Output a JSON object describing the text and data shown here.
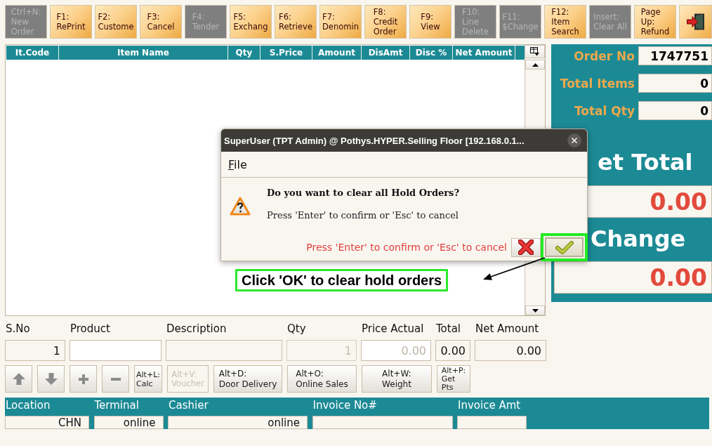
{
  "toolbar": {
    "buttons": [
      {
        "kind": "text",
        "lines": [
          "Ctrl+N:",
          "New",
          "Order"
        ],
        "disabled": true
      },
      {
        "kind": "text",
        "lines": [
          "F1:",
          "RePrint"
        ],
        "disabled": false
      },
      {
        "kind": "text",
        "lines": [
          "F2:",
          "Custome"
        ],
        "disabled": false
      },
      {
        "kind": "text",
        "lines": [
          "F3:",
          "Cancel"
        ],
        "disabled": false
      },
      {
        "kind": "text",
        "lines": [
          "F4:",
          "Tender"
        ],
        "disabled": true
      },
      {
        "kind": "text",
        "lines": [
          "F5:",
          "Exchang"
        ],
        "disabled": false
      },
      {
        "kind": "text",
        "lines": [
          "F6:",
          "Retrieve"
        ],
        "disabled": false
      },
      {
        "kind": "text",
        "lines": [
          "F7:",
          "Denomin"
        ],
        "disabled": false
      },
      {
        "kind": "text",
        "lines": [
          "F8:",
          "Credit",
          "Order"
        ],
        "disabled": false
      },
      {
        "kind": "text",
        "lines": [
          "F9:",
          "View"
        ],
        "disabled": false
      },
      {
        "kind": "text",
        "lines": [
          "F10:",
          "Line",
          "Delete"
        ],
        "disabled": true
      },
      {
        "kind": "text",
        "lines": [
          "F11:",
          "$Change"
        ],
        "disabled": true
      },
      {
        "kind": "text",
        "lines": [
          "F12:",
          "Item",
          "Search"
        ],
        "disabled": false
      },
      {
        "kind": "text",
        "lines": [
          "Insert:",
          "Clear All"
        ],
        "disabled": true
      },
      {
        "kind": "text",
        "lines": [
          "Page",
          "Up:",
          "Refund"
        ],
        "disabled": false
      },
      {
        "kind": "exit",
        "disabled": false
      }
    ]
  },
  "items_table": {
    "columns": [
      "It.Code",
      "Item Name",
      "Qty",
      "S.Price",
      "Amount",
      "DisAmt",
      "Disc %",
      "Net Amount"
    ]
  },
  "summary": {
    "fields": [
      {
        "label": "Order No",
        "value": "1747751"
      },
      {
        "label": "Total Items",
        "value": "0"
      },
      {
        "label": "Total Qty",
        "value": "0"
      }
    ],
    "totals": [
      {
        "label": "et Total",
        "value": "0.00"
      },
      {
        "label": "Change",
        "value": "0.00"
      }
    ]
  },
  "dialog": {
    "title": "SuperUser (TPT Admin) @ Pothys.HYPER.Selling Floor [192.168.0.1...",
    "menu": [
      {
        "label": "File"
      }
    ],
    "question": "Do you want to clear all Hold Orders?",
    "message": "Press 'Enter' to confirm or 'Esc' to cancel",
    "hint": "Press 'Enter' to confirm or 'Esc' to cancel",
    "buttons": [
      {
        "kind": "cancel",
        "highlighted": false
      },
      {
        "kind": "ok",
        "highlighted": true
      }
    ]
  },
  "callout": {
    "text": "Click 'OK' to clear hold orders"
  },
  "entry": {
    "fields": [
      {
        "label": "S.No",
        "value": "1",
        "editable": false,
        "disabled": false
      },
      {
        "label": "Product",
        "editable": true,
        "disabled": false
      },
      {
        "label": "Description",
        "editable": false,
        "disabled": false
      },
      {
        "label": "Qty",
        "value": "1",
        "editable": false,
        "disabled": true
      },
      {
        "label": "Price Actual",
        "placeholder": "0.00",
        "editable": true,
        "disabled": false
      },
      {
        "label": "Total",
        "value": "0.00",
        "editable": false,
        "disabled": false
      },
      {
        "label": "Net Amount",
        "value": "0.00",
        "editable": false,
        "disabled": false
      }
    ]
  },
  "actions": [
    {
      "kind": "up"
    },
    {
      "kind": "down"
    },
    {
      "kind": "add"
    },
    {
      "kind": "remove"
    },
    {
      "kind": "text",
      "lines": [
        "Alt+L:",
        "Calc"
      ],
      "disabled": false
    },
    {
      "kind": "text",
      "lines": [
        "Alt+V:",
        "Voucher"
      ],
      "disabled": true
    },
    {
      "kind": "text",
      "lines": [
        "Alt+D:",
        "Door Delivery"
      ],
      "disabled": false
    },
    {
      "kind": "text",
      "lines": [
        "Alt+O:",
        "Online Sales"
      ],
      "disabled": false
    },
    {
      "kind": "text",
      "lines": [
        "Alt+W:",
        "Weight"
      ],
      "disabled": false
    },
    {
      "kind": "text",
      "lines": [
        "Alt+P:",
        "Get",
        "Pts"
      ],
      "disabled": false
    }
  ],
  "status_bar": {
    "fields": [
      {
        "label": "Location",
        "value": "CHN"
      },
      {
        "label": "Terminal",
        "value": "online"
      },
      {
        "label": "Cashier",
        "value": "online"
      },
      {
        "label": "Invoice No#"
      },
      {
        "label": "Invoice Amt"
      }
    ]
  }
}
